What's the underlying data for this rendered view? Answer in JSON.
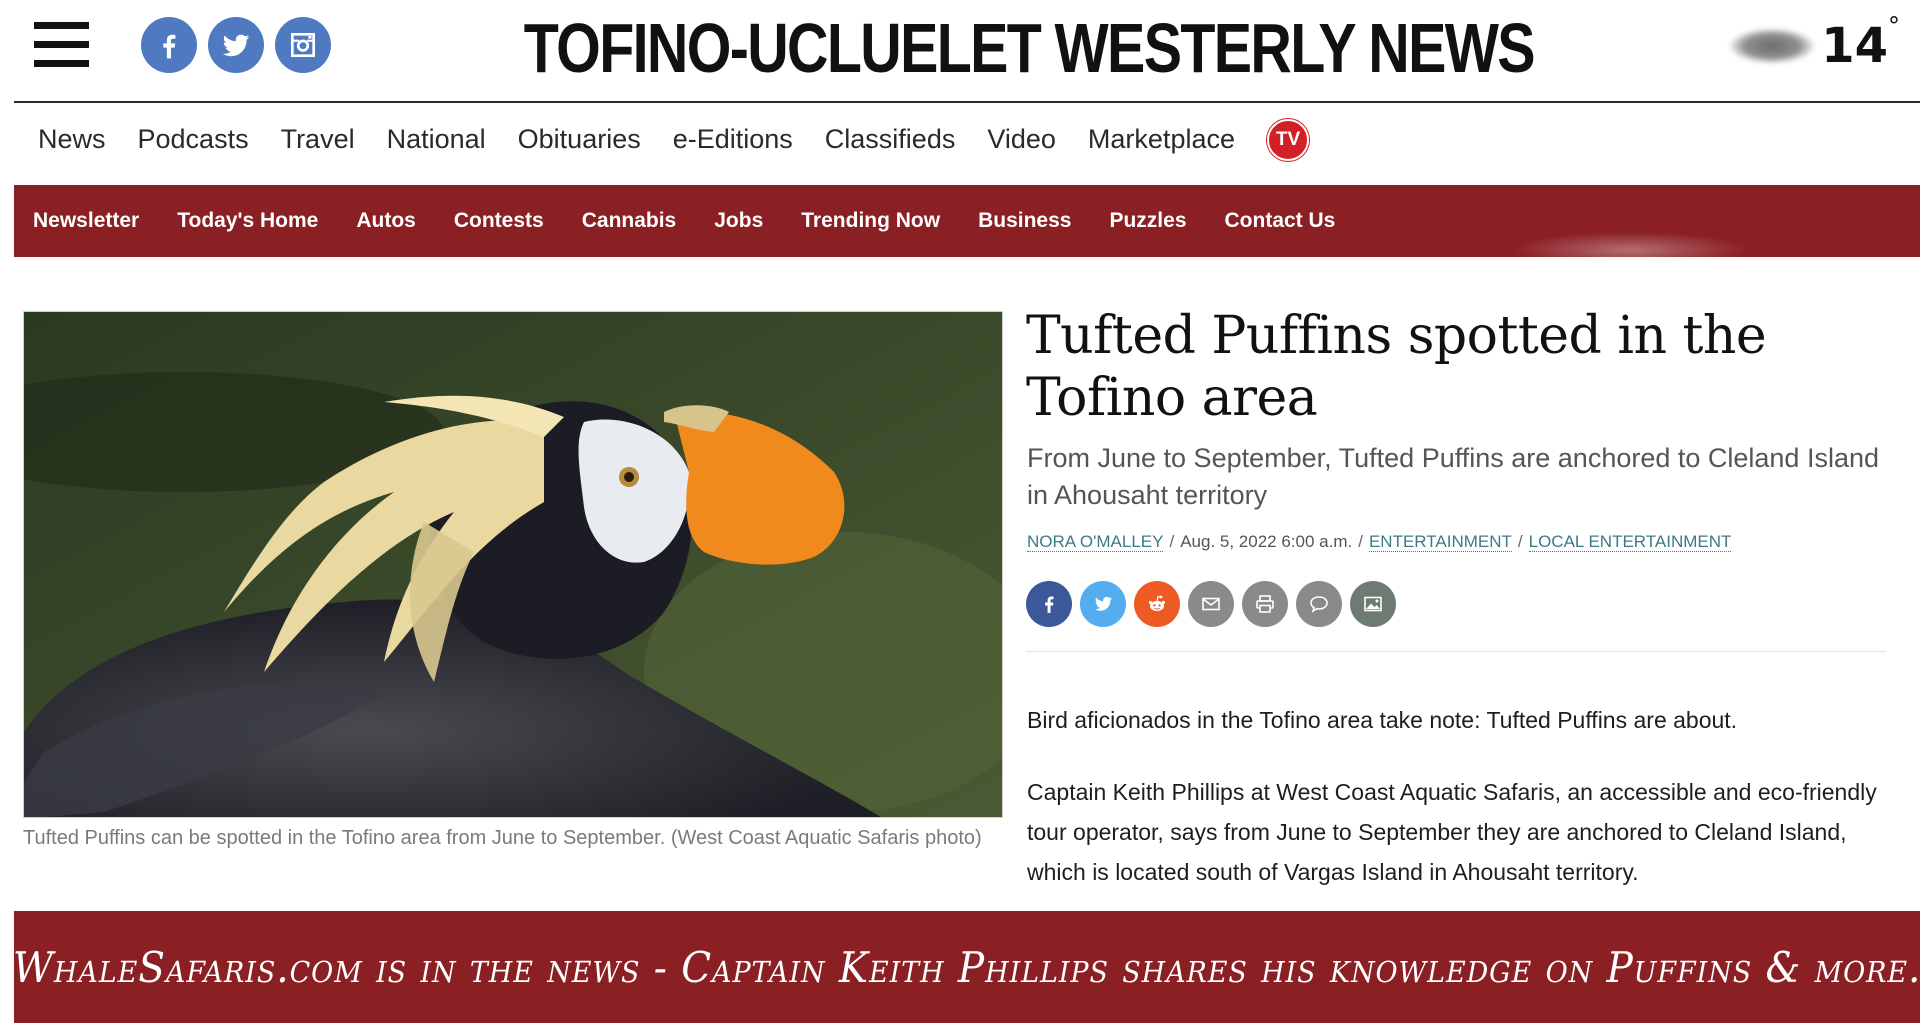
{
  "masthead": {
    "site_title": "TOFINO-UCLUELET WESTERLY NEWS",
    "social": [
      {
        "name": "facebook",
        "icon": "facebook-icon"
      },
      {
        "name": "twitter",
        "icon": "twitter-icon"
      },
      {
        "name": "instagram",
        "icon": "instagram-icon"
      }
    ],
    "weather": {
      "temperature": "14",
      "degree_symbol": "°",
      "icon": "cloud-icon"
    }
  },
  "primary_nav": {
    "items": [
      "News",
      "Podcasts",
      "Travel",
      "National",
      "Obituaries",
      "e-Editions",
      "Classifieds",
      "Video",
      "Marketplace"
    ],
    "tv_badge": "TV"
  },
  "secondary_nav": {
    "items": [
      "Newsletter",
      "Today's Home",
      "Autos",
      "Contests",
      "Cannabis",
      "Jobs",
      "Trending Now",
      "Business",
      "Puzzles",
      "Contact Us"
    ]
  },
  "article": {
    "image_caption": "Tufted Puffins can be spotted in the Tofino area from June to September. (West Coast Aquatic Safaris photo)",
    "headline": "Tufted Puffins spotted in the Tofino area",
    "subhead": "From June to September, Tufted Puffins are anchored to Cleland Island in Ahousaht territory",
    "byline": {
      "author": "NORA O'MALLEY",
      "date": "Aug. 5, 2022 6:00 a.m.",
      "category": "ENTERTAINMENT",
      "subcategory": "LOCAL ENTERTAINMENT",
      "separator": "/"
    },
    "share_icons": [
      "facebook-icon",
      "twitter-icon",
      "reddit-icon",
      "email-icon",
      "print-icon",
      "comment-icon",
      "photo-gallery-icon"
    ],
    "paragraphs": [
      "Bird aficionados in the Tofino area take note: Tufted Puffins are about.",
      "Captain Keith Phillips at West Coast Aquatic Safaris, an accessible and eco-friendly tour operator, says from June to September they are anchored to Cleland Island, which is located south of Vargas Island in Ahousaht territory."
    ]
  },
  "banner": {
    "text": "WhaleSafaris.com is in the news - Captain Keith Phillips shares his knowledge on Puffins & more."
  },
  "colors": {
    "brand_red": "#8a1f24",
    "social_blue": "#4f79c0",
    "link_teal": "#3d7a85",
    "tv_red": "#d32027"
  }
}
